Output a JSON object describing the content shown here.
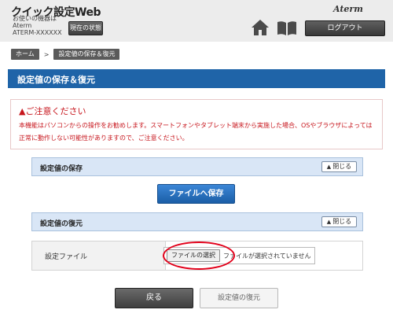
{
  "header": {
    "app_title": "クイック設定Web",
    "device_caption": "お使いの機器は",
    "device_brand": "Aterm",
    "device_id": "ATERM-XXXXXX",
    "status_button": "現在の状態",
    "brand_logo": "Aterm",
    "logout_button": "ログアウト"
  },
  "breadcrumb": {
    "home": "ホーム",
    "separator": ">",
    "current": "設定値の保存＆復元"
  },
  "page_title": "設定値の保存＆復元",
  "notice": {
    "title": "ご注意ください",
    "body": "本機能はパソコンからの操作をお勧めします。スマートフォンやタブレット端末から実施した場合、OSやブラウザによっては正常に動作しない可能性がありますので、ご注意ください。"
  },
  "save_section": {
    "label": "設定値の保存",
    "close_label": "閉じる",
    "save_button": "ファイルへ保存"
  },
  "restore_section": {
    "label": "設定値の復元",
    "close_label": "閉じる",
    "file_label": "設定ファイル",
    "choose_button": "ファイルの選択",
    "file_status": "ファイルが選択されていません"
  },
  "footer": {
    "back_button": "戻る",
    "restore_button": "設定値の復元"
  },
  "colors": {
    "title_bar": "#1f64a8",
    "notice_text": "#c7161d",
    "section_bar": "#d9e6f6",
    "highlight": "#e2001a"
  }
}
